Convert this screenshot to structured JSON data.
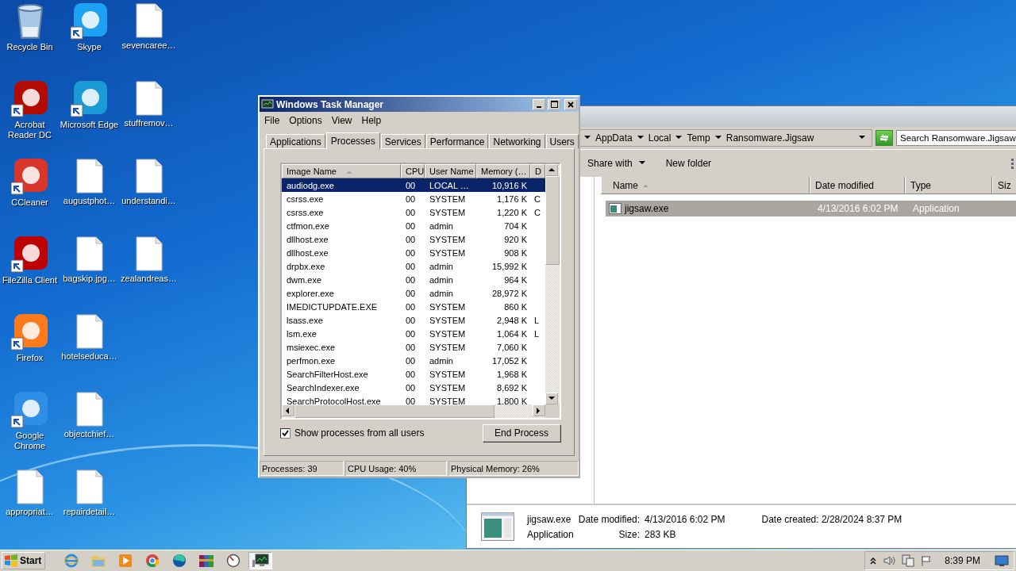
{
  "desktop": {
    "columns": [
      [
        {
          "label": "Recycle Bin",
          "kind": "bin"
        },
        {
          "label": "Acrobat Reader DC",
          "kind": "shortcut",
          "color": "#b30b00"
        },
        {
          "label": "CCleaner",
          "kind": "shortcut",
          "color": "#d8362a"
        },
        {
          "label": "FileZilla Client",
          "kind": "shortcut",
          "color": "#bf0000"
        },
        {
          "label": "Firefox",
          "kind": "shortcut",
          "color": "#ff7a1a"
        },
        {
          "label": "Google Chrome",
          "kind": "shortcut",
          "color": "#2f8ee6"
        },
        {
          "label": "appropriat…",
          "kind": "document"
        }
      ],
      [
        {
          "label": "Skype",
          "kind": "shortcut",
          "color": "#1da1f2"
        },
        {
          "label": "Microsoft Edge",
          "kind": "shortcut",
          "color": "#1c9ad6"
        },
        {
          "label": "augustphot…",
          "kind": "document"
        },
        {
          "label": "bagskip.jpg…",
          "kind": "document"
        },
        {
          "label": "hotelseduca…",
          "kind": "document"
        },
        {
          "label": "objectchief…",
          "kind": "document"
        },
        {
          "label": "repairdetail…",
          "kind": "document"
        }
      ],
      [
        {
          "label": "sevencaree…",
          "kind": "document"
        },
        {
          "label": "stuffremov…",
          "kind": "document"
        },
        {
          "label": "understandi…",
          "kind": "document"
        },
        {
          "label": "zealandreas…",
          "kind": "document"
        }
      ]
    ]
  },
  "explorer": {
    "breadcrumbs": [
      "AppData",
      "Local",
      "Temp",
      "Ransomware.Jigsaw"
    ],
    "search": {
      "placeholder": "Search Ransomware.Jigsaw"
    },
    "toolbar": [
      "Share with",
      "New folder"
    ],
    "columns": [
      "Name",
      "Date modified",
      "Type",
      "Siz"
    ],
    "rows": [
      {
        "name": "jigsaw.exe",
        "date_modified": "4/13/2016 6:02 PM",
        "type": "Application",
        "selected": true
      }
    ],
    "details": {
      "name": "jigsaw.exe",
      "kind_label": "Application",
      "date_modified_label": "Date modified:",
      "date_modified": "4/13/2016 6:02 PM",
      "size_label": "Size:",
      "size": "283 KB",
      "date_created_label": "Date created:",
      "date_created": "2/28/2024 8:37 PM"
    }
  },
  "task_manager": {
    "window": {
      "title": "Windows Task Manager"
    },
    "menu": [
      "File",
      "Options",
      "View",
      "Help"
    ],
    "tabs": [
      {
        "label": "Applications",
        "selected": false
      },
      {
        "label": "Processes",
        "selected": true
      },
      {
        "label": "Services",
        "selected": false
      },
      {
        "label": "Performance",
        "selected": false
      },
      {
        "label": "Networking",
        "selected": false
      },
      {
        "label": "Users",
        "selected": false
      }
    ],
    "table": {
      "columns": [
        "Image Name",
        "CPU",
        "User Name",
        "Memory (…",
        "D"
      ],
      "rows": [
        {
          "image_name": "audiodg.exe",
          "cpu": "00",
          "user_name": "LOCAL …",
          "memory": "10,916 K",
          "selected": true
        },
        {
          "image_name": "csrss.exe",
          "cpu": "00",
          "user_name": "SYSTEM",
          "memory": "1,176 K",
          "column_5": "C",
          "selected": false
        },
        {
          "image_name": "csrss.exe",
          "cpu": "00",
          "user_name": "SYSTEM",
          "memory": "1,220 K",
          "column_5": "C",
          "selected": false
        },
        {
          "image_name": "ctfmon.exe",
          "cpu": "00",
          "user_name": "admin",
          "memory": "704 K",
          "selected": false
        },
        {
          "image_name": "dllhost.exe",
          "cpu": "00",
          "user_name": "SYSTEM",
          "memory": "920 K",
          "selected": false
        },
        {
          "image_name": "dllhost.exe",
          "cpu": "00",
          "user_name": "SYSTEM",
          "memory": "908 K",
          "selected": false
        },
        {
          "image_name": "drpbx.exe",
          "cpu": "00",
          "user_name": "admin",
          "memory": "15,992 K",
          "selected": false
        },
        {
          "image_name": "dwm.exe",
          "cpu": "00",
          "user_name": "admin",
          "memory": "964 K",
          "selected": false
        },
        {
          "image_name": "explorer.exe",
          "cpu": "00",
          "user_name": "admin",
          "memory": "28,972 K",
          "selected": false
        },
        {
          "image_name": "IMEDICTUPDATE.EXE",
          "cpu": "00",
          "user_name": "SYSTEM",
          "memory": "860 K",
          "selected": false
        },
        {
          "image_name": "lsass.exe",
          "cpu": "00",
          "user_name": "SYSTEM",
          "memory": "2,948 K",
          "column_5": "L",
          "selected": false
        },
        {
          "image_name": "lsm.exe",
          "cpu": "00",
          "user_name": "SYSTEM",
          "memory": "1,064 K",
          "column_5": "L",
          "selected": false
        },
        {
          "image_name": "msiexec.exe",
          "cpu": "00",
          "user_name": "SYSTEM",
          "memory": "7,060 K",
          "selected": false
        },
        {
          "image_name": "perfmon.exe",
          "cpu": "00",
          "user_name": "admin",
          "memory": "17,052 K",
          "selected": false
        },
        {
          "image_name": "SearchFilterHost.exe",
          "cpu": "00",
          "user_name": "SYSTEM",
          "memory": "1,968 K",
          "selected": false
        },
        {
          "image_name": "SearchIndexer.exe",
          "cpu": "00",
          "user_name": "SYSTEM",
          "memory": "8,692 K",
          "selected": false
        },
        {
          "image_name": "SearchProtocolHost.exe",
          "cpu": "00",
          "user_name": "SYSTEM",
          "memory": "1,800 K",
          "selected": false
        }
      ]
    },
    "show_all_users": {
      "label": "Show processes from all users",
      "checked": true
    },
    "end_button": "End Process",
    "status_bar": [
      "Processes: 39",
      "CPU Usage: 40%",
      "Physical Memory: 26%"
    ]
  },
  "taskbar": {
    "start": "Start",
    "buttons": [
      {
        "kind": "ie",
        "selected": false
      },
      {
        "kind": "folder",
        "selected": false
      },
      {
        "kind": "media",
        "selected": false
      },
      {
        "kind": "chrome",
        "selected": false
      },
      {
        "kind": "edge",
        "selected": false
      },
      {
        "kind": "archive",
        "selected": false
      },
      {
        "kind": "gauge",
        "selected": false
      },
      {
        "kind": "monitor",
        "selected": true
      }
    ],
    "clock": "8:39 PM"
  }
}
